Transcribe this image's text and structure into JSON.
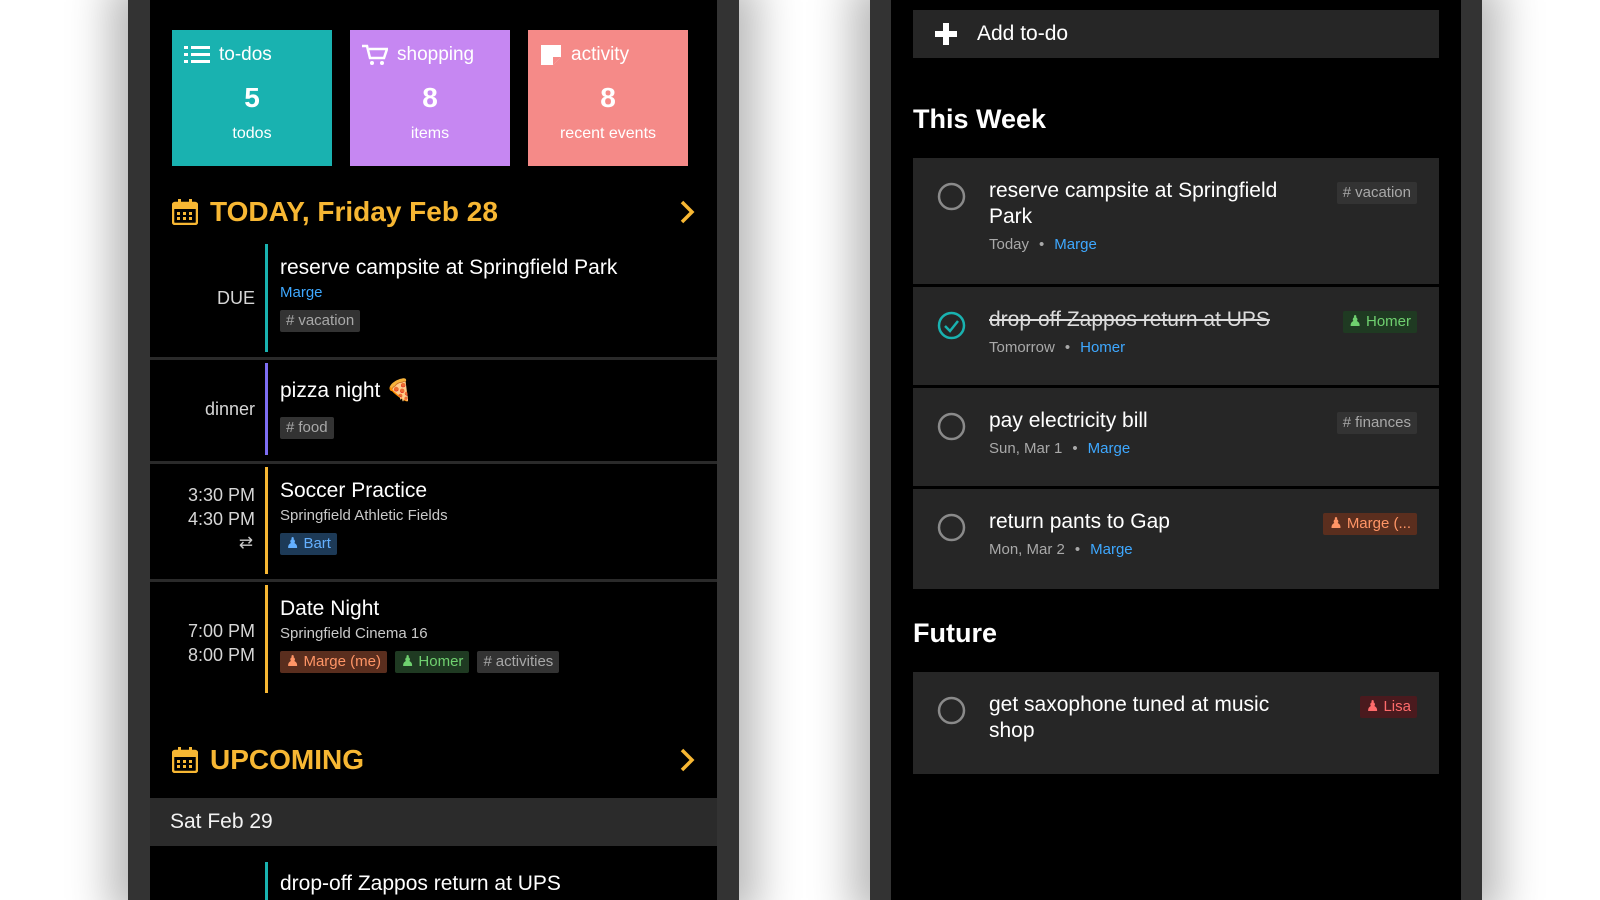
{
  "summary": {
    "todos": {
      "label": "to-dos",
      "count": "5",
      "sub": "todos",
      "color": "#19b2b0",
      "icon": "list-icon"
    },
    "shopping": {
      "label": "shopping",
      "count": "8",
      "sub": "items",
      "color": "#c687f2",
      "icon": "cart-icon"
    },
    "activity": {
      "label": "activity",
      "count": "8",
      "sub": "recent events",
      "color": "#f58a88",
      "icon": "note-icon"
    }
  },
  "today": {
    "title": "TODAY, Friday Feb 28",
    "events": [
      {
        "time": "DUE",
        "title": "reserve campsite at Springfield Park",
        "who": "Marge",
        "tags": [
          "vacation"
        ],
        "bar_color": "#19b2b0"
      },
      {
        "time": "dinner",
        "title": "pizza night",
        "emoji": "🍕",
        "tags": [
          "food"
        ],
        "bar_color": "#7d6df2"
      },
      {
        "time_start": "3:30 PM",
        "time_end": "4:30 PM",
        "title": "Soccer Practice",
        "location": "Springfield Athletic Fields",
        "tags": [
          "Bart"
        ],
        "bar_color": "#f7b733",
        "repeat": true
      },
      {
        "time_start": "7:00 PM",
        "time_end": "8:00 PM",
        "title": "Date Night",
        "location": "Springfield Cinema 16",
        "tags": [
          "Marge (me)",
          "Homer",
          "activities"
        ],
        "bar_color": "#f7b733"
      }
    ]
  },
  "upcoming": {
    "title": "UPCOMING",
    "day": "Sat Feb 29",
    "next_title": "drop-off Zappos return at UPS"
  },
  "todo_list": {
    "add_label": "Add to-do",
    "this_week_title": "This Week",
    "future_title": "Future",
    "this_week": [
      {
        "title": "reserve campsite at Springfield Park",
        "when": "Today",
        "who": "Marge",
        "tag": "vacation",
        "done": false
      },
      {
        "title": "drop-off Zappos return at UPS",
        "when": "Tomorrow",
        "who": "Homer",
        "tag": "Homer",
        "done": true
      },
      {
        "title": "pay electricity bill",
        "when": "Sun, Mar 1",
        "who": "Marge",
        "tag": "finances",
        "done": false
      },
      {
        "title": "return pants to Gap",
        "when": "Mon, Mar 2",
        "who": "Marge",
        "tag": "Marge (...",
        "done": false
      }
    ],
    "future": [
      {
        "title": "get saxophone tuned at music shop",
        "tag": "Lisa",
        "done": false
      }
    ]
  },
  "colors": {
    "accent_yellow": "#f7b733",
    "link_blue": "#3ea8ff",
    "check_teal": "#19b2b0"
  }
}
